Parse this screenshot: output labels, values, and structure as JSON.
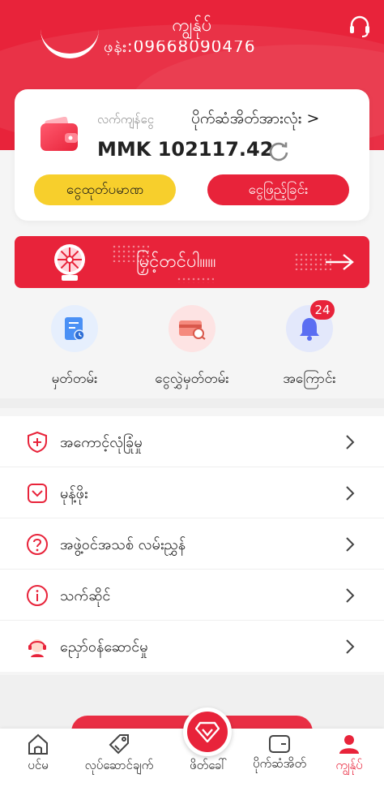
{
  "header": {
    "title": "ကျွန်ုပ်",
    "phone_partial": "ဖုန်း:09668090476"
  },
  "wallet": {
    "balance_label": "လက်ကျန်ငွေ",
    "history_link": "ပိုက်ဆံအိတ်အားလုံး >",
    "balance": "MMK 102117.42",
    "topup_label": "ငွေထုတ်ပမာဏ",
    "withdraw_label": "ငွေဖြည့်ခြင်း"
  },
  "promo": {
    "text": "မြှင့်တင်ပါ။။။"
  },
  "quick_actions": [
    {
      "label": "မှတ်တမ်း",
      "icon": "record-icon"
    },
    {
      "label": "ငွေလွှဲမှတ်တမ်း",
      "icon": "transfer-record-icon"
    },
    {
      "label": "အကြောင်း",
      "icon": "bell-icon",
      "badge": "24"
    }
  ],
  "menu": [
    {
      "label": "အကောင့်လုံခြုံမှု",
      "icon": "shield-icon"
    },
    {
      "label": "မုန့်ဖိုး",
      "icon": "pocket-icon"
    },
    {
      "label": "အဖွဲ့ဝင်အသစ် လမ်းညွှန်",
      "icon": "question-icon"
    },
    {
      "label": "သက်ဆိုင်",
      "icon": "info-icon"
    },
    {
      "label": "ညှော်ဝန်ဆောင်မှု",
      "icon": "customer-service-icon"
    }
  ],
  "tabbar": [
    {
      "label": "ပင်မ",
      "icon": "home-icon"
    },
    {
      "label": "လုပ်ဆောင်ချက်",
      "icon": "tag-icon"
    },
    {
      "label": "ဖိတ်ခေါ်",
      "icon": "invite-icon"
    },
    {
      "label": "ပိုက်ဆံအိတ်",
      "icon": "wallet-icon"
    },
    {
      "label": "ကျွန်ုပ်",
      "icon": "profile-icon",
      "active": true
    }
  ],
  "colors": {
    "primary": "#e8233a",
    "accent_yellow": "#f7cf2c",
    "background": "#f5f5f5"
  }
}
